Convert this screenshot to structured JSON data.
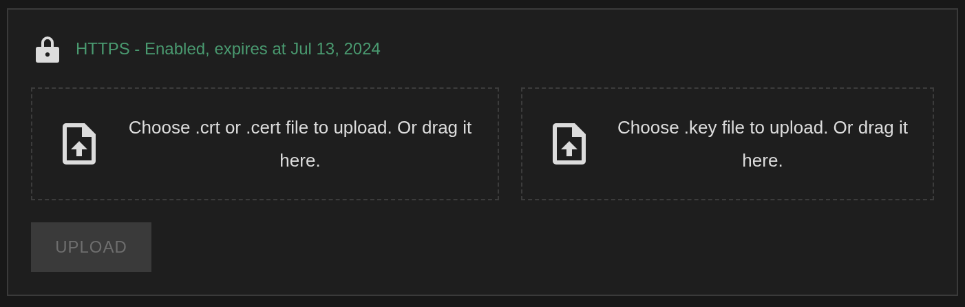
{
  "status": {
    "text": "HTTPS - Enabled, expires at Jul 13, 2024",
    "enabled": true
  },
  "dropzones": [
    {
      "text": "Choose .crt or .cert file to upload. Or drag it here."
    },
    {
      "text": "Choose .key file to upload. Or drag it here."
    }
  ],
  "upload_button": {
    "label": "UPLOAD",
    "disabled": true
  }
}
